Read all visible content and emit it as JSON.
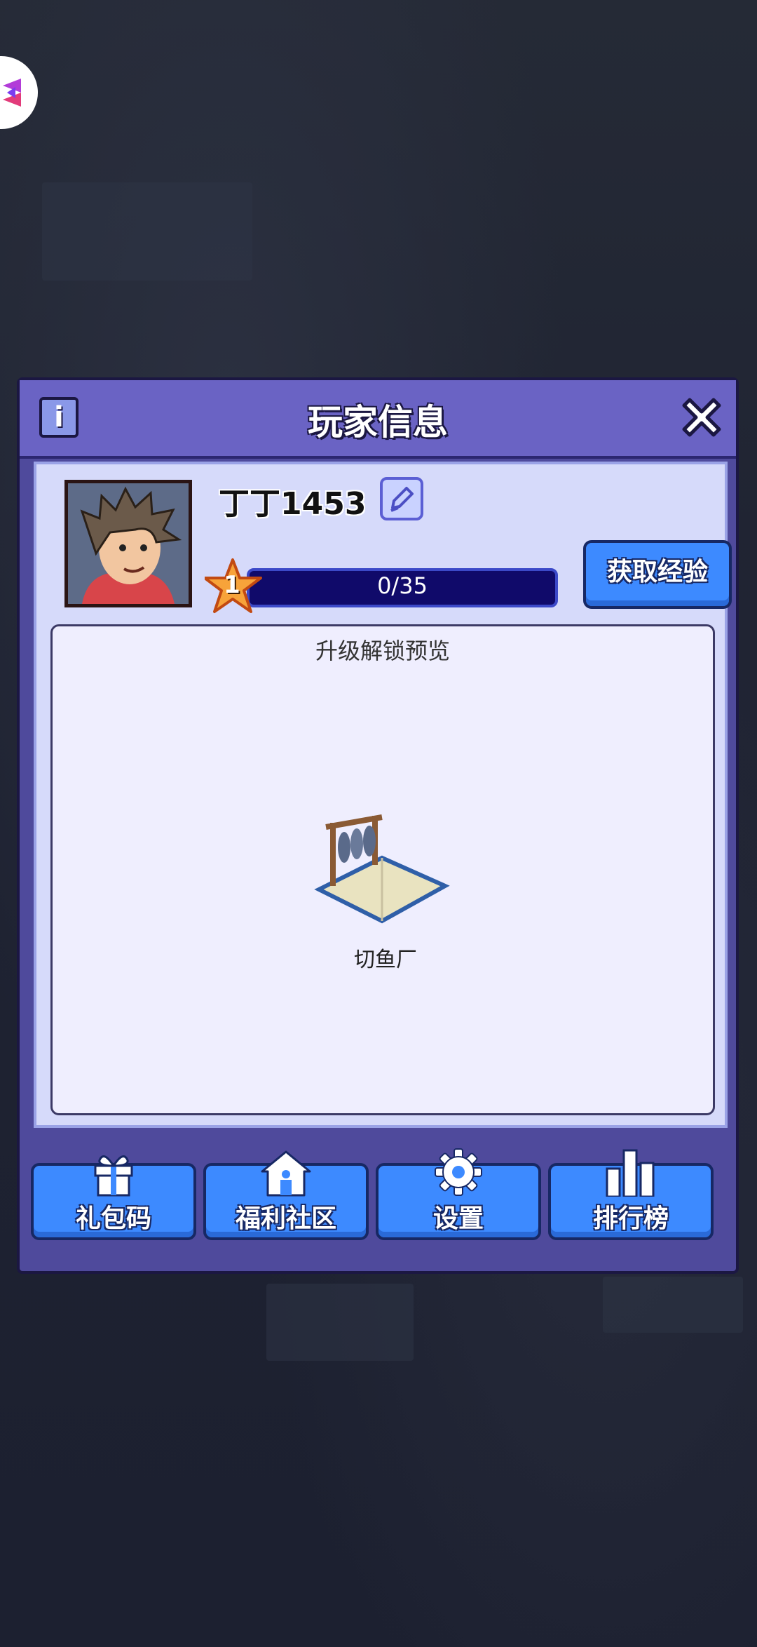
{
  "dialog": {
    "title": "玩家信息"
  },
  "player": {
    "name": "丁丁1453",
    "level": "1",
    "xp_text": "0/35",
    "xp_progress": 0
  },
  "buttons": {
    "get_exp": "获取经验"
  },
  "preview": {
    "title": "升级解锁预览",
    "item_name": "切鱼厂"
  },
  "bottom_nav": [
    {
      "label": "礼包码",
      "icon": "gift-icon"
    },
    {
      "label": "福利社区",
      "icon": "house-icon"
    },
    {
      "label": "设置",
      "icon": "gear-icon"
    },
    {
      "label": "排行榜",
      "icon": "bar-chart-icon"
    }
  ],
  "colors": {
    "panel": "#4f4a9c",
    "title_bar": "#6a63c4",
    "button": "#3d8aff",
    "xp_bar": "#100a6a"
  }
}
